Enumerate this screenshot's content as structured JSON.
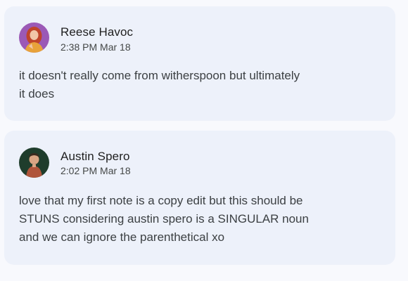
{
  "comments": [
    {
      "author": "Reese Havoc",
      "time": "2:38 PM Mar 18",
      "lines": [
        "it doesn't really come from witherspoon but ultimately",
        "it does"
      ],
      "avatar_icon": "person-photo-icon",
      "avatar_colors": {
        "bg": "#9b59b6",
        "hair": "#c0442a",
        "shirt": "#e8a23a",
        "skin": "#f1c6a8"
      }
    },
    {
      "author": "Austin Spero",
      "time": "2:02 PM Mar 18",
      "lines": [
        "love that my first note is a copy edit but this should be",
        "STUNS considering austin spero is a SINGULAR noun",
        "and we can ignore the parenthetical xo"
      ],
      "avatar_icon": "person-photo-icon",
      "avatar_colors": {
        "bg": "#1f3d2c",
        "hair": "#3a2a1e",
        "shirt": "#b0553b",
        "skin": "#d9a584"
      }
    }
  ]
}
